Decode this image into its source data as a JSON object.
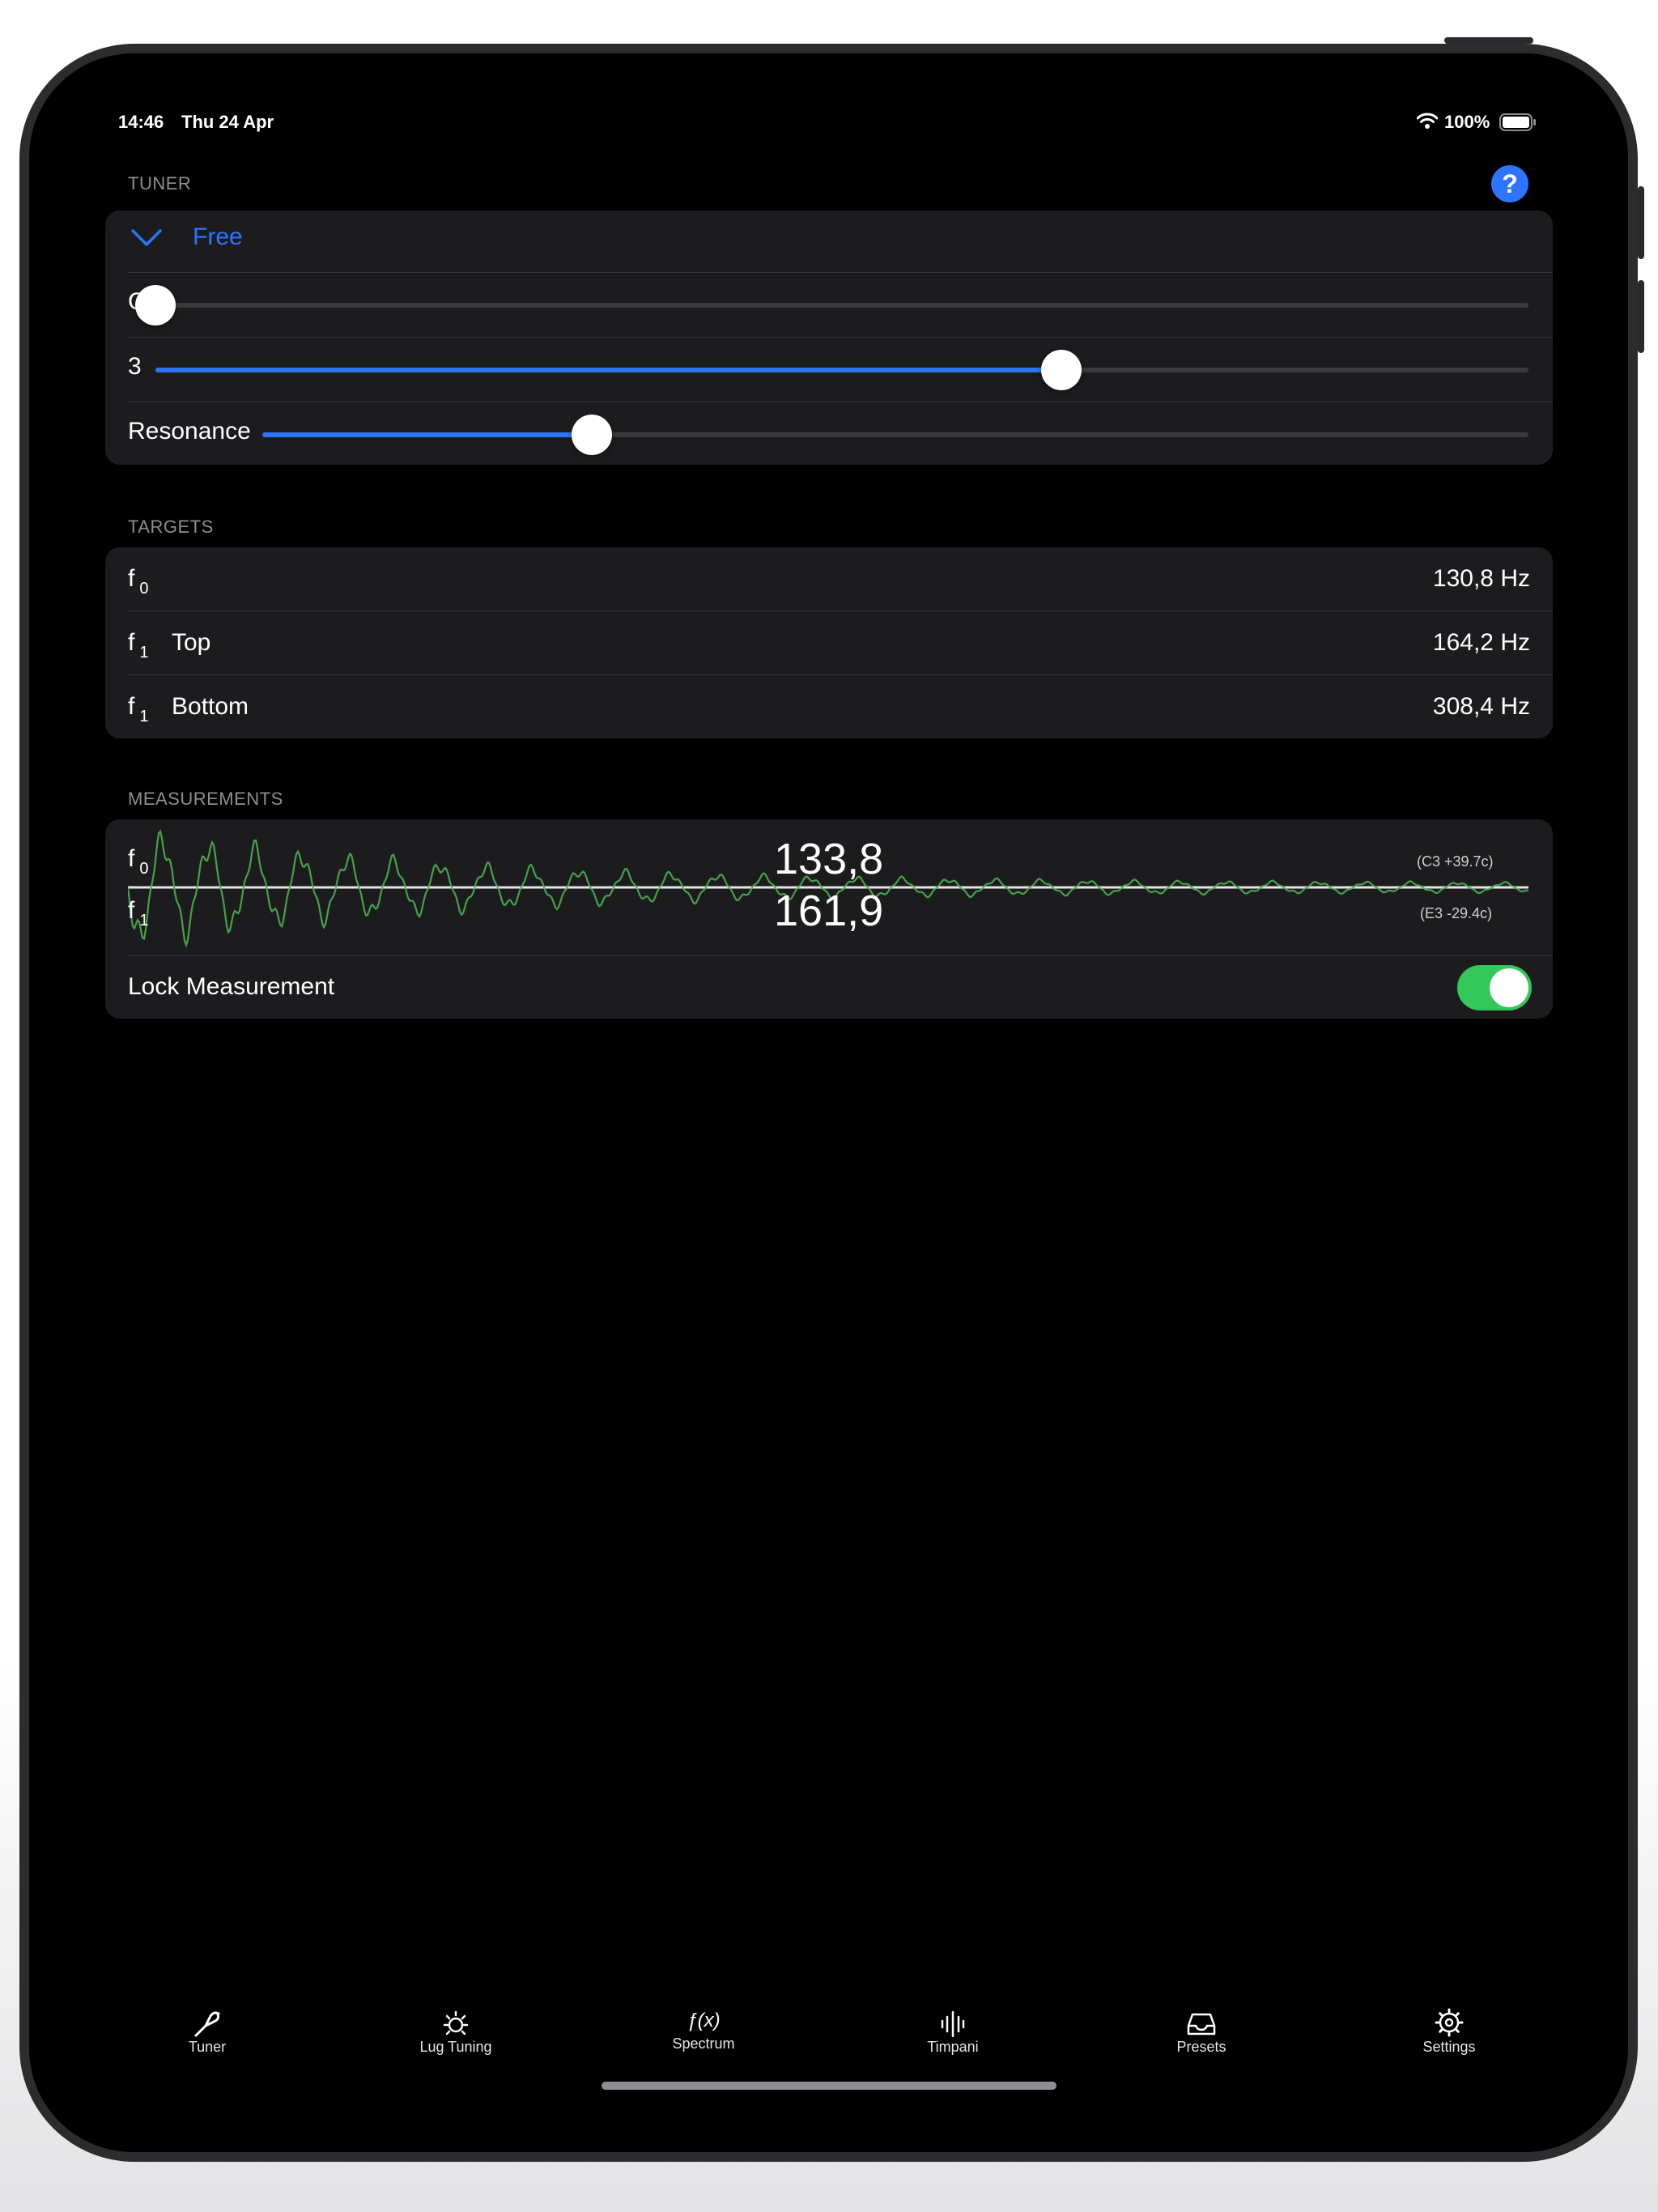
{
  "status_bar": {
    "time": "14:46",
    "date": "Thu 24 Apr",
    "battery_percent": "100%"
  },
  "tuner": {
    "section_label": "TUNER",
    "mode": "Free",
    "note_label": "C",
    "note_slider_value": 0,
    "octave_label": "3",
    "octave_slider_value": 0.66,
    "resonance_label": "Resonance",
    "resonance_slider_value": 0.26
  },
  "targets": {
    "section_label": "TARGETS",
    "rows": [
      {
        "symbol": "f",
        "sub": "0",
        "name": "",
        "value": "130,8 Hz"
      },
      {
        "symbol": "f",
        "sub": "1",
        "name": "Top",
        "value": "164,2 Hz"
      },
      {
        "symbol": "f",
        "sub": "1",
        "name": "Bottom",
        "value": "308,4 Hz"
      }
    ]
  },
  "measurements": {
    "section_label": "MEASUREMENTS",
    "f0": {
      "symbol": "f",
      "sub": "0",
      "value": "133,8",
      "note": "(C3 +39.7c)"
    },
    "f1": {
      "symbol": "f",
      "sub": "1",
      "value": "161,9",
      "note": "(E3 -29.4c)"
    },
    "lock_label": "Lock Measurement",
    "lock_on": true
  },
  "tabs": [
    {
      "label": "Tuner",
      "icon": "tuning-fork-icon"
    },
    {
      "label": "Lug Tuning",
      "icon": "lug-icon"
    },
    {
      "label": "Spectrum",
      "icon": "function-icon",
      "glyph": "ƒ(x)"
    },
    {
      "label": "Timpani",
      "icon": "waveform-icon"
    },
    {
      "label": "Presets",
      "icon": "tray-icon"
    },
    {
      "label": "Settings",
      "icon": "gear-icon"
    }
  ],
  "colors": {
    "accent": "#2d74ff",
    "toggle_on": "#34c759",
    "waveform": "#4caf50",
    "card": "#1c1c1e"
  }
}
